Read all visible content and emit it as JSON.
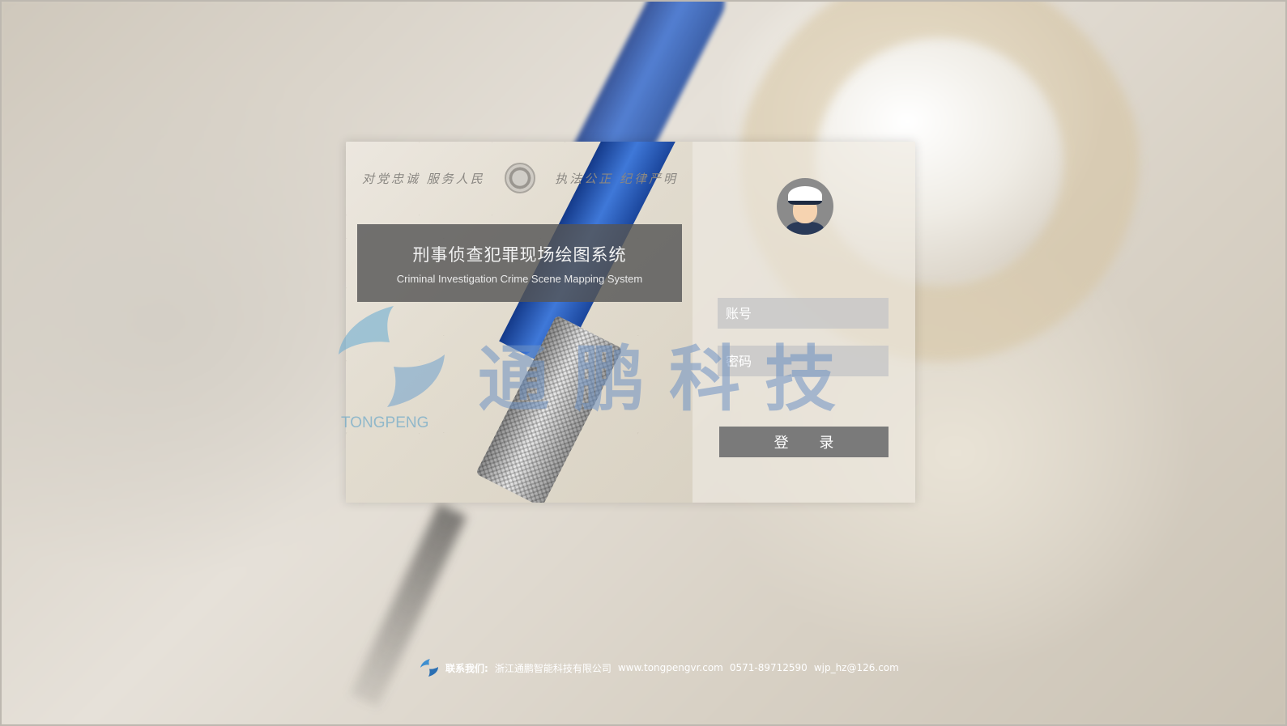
{
  "window": {
    "title": "刑事侦查犯罪现场绘图系统"
  },
  "banner": {
    "slogan_left": "对党忠诚 服务人民",
    "slogan_right": "执法公正 纪律严明",
    "emblem_icon": "police-emblem-icon"
  },
  "title": {
    "cn": "刑事侦查犯罪现场绘图系统",
    "en": "Criminal Investigation Crime Scene Mapping System"
  },
  "login": {
    "avatar_icon": "police-officer-avatar-icon",
    "account_placeholder": "账号",
    "account_value": "",
    "password_placeholder": "密码",
    "password_value": "",
    "submit_label": "登  录"
  },
  "watermark": {
    "cn": "通鹏科技",
    "en": "TONGPENG",
    "logo_icon": "tongpeng-logo-icon"
  },
  "footer": {
    "contact_label": "联系我们:",
    "company": "浙江通鹏智能科技有限公司",
    "website": "www.tongpengvr.com",
    "phone": "0571-89712590",
    "email": "wjp_hz@126.com"
  },
  "colors": {
    "title_panel": "#555555",
    "button": "#7a7a7a",
    "input_bg": "#c8c8c8",
    "watermark_blue": "#6e91c3"
  }
}
